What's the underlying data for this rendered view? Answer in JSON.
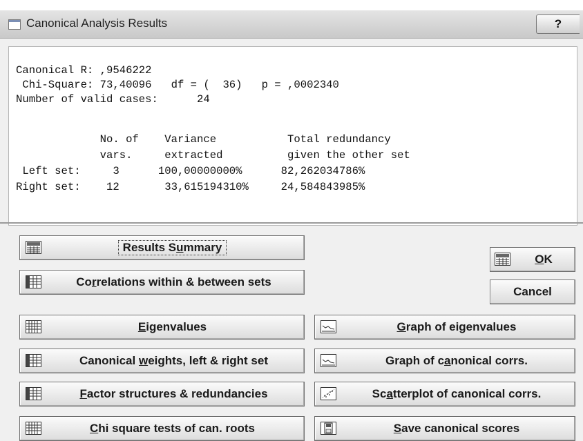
{
  "window": {
    "title": "Canonical Analysis Results",
    "help_label": "?"
  },
  "output": {
    "lines": [
      "Canonical R: ,9546222",
      " Chi-Square: 73,40096   df = (  36)   p = ,0002340",
      "Number of valid cases:      24",
      "",
      "",
      "             No. of    Variance           Total redundancy",
      "             vars.     extracted          given the other set",
      " Left set:     3      100,00000000%      82,262034786%",
      "Right set:    12       33,615194310%     24,584843985%"
    ]
  },
  "buttons": {
    "results_summary": {
      "pre": "Results S",
      "u": "u",
      "post": "mmary",
      "icon": "summary-icon"
    },
    "correlations": {
      "pre": "Co",
      "u": "r",
      "post": "relations within & between sets",
      "icon": "table-icon"
    },
    "eigenvalues": {
      "pre": "",
      "u": "E",
      "post": "igenvalues",
      "icon": "grid-icon"
    },
    "canonical_weights": {
      "pre": "Canonical ",
      "u": "w",
      "post": "eights, left & right set",
      "icon": "table-icon"
    },
    "factor_structures": {
      "pre": "",
      "u": "F",
      "post": "actor structures & redundancies",
      "icon": "table-icon"
    },
    "chi_square": {
      "pre": "",
      "u": "C",
      "post": "hi square tests of can. roots",
      "icon": "grid-icon"
    },
    "ok": {
      "pre": "",
      "u": "O",
      "post": "K",
      "icon": "summary-icon"
    },
    "cancel": {
      "label": "Cancel"
    },
    "graph_eigenvalues": {
      "pre": "",
      "u": "G",
      "post": "raph of eigenvalues",
      "icon": "line-graph-icon"
    },
    "graph_canonical": {
      "pre": "Graph of c",
      "u": "a",
      "post": "nonical corrs.",
      "icon": "line-graph-icon"
    },
    "scatterplot": {
      "pre": "Sc",
      "u": "a",
      "post": "tterplot of canonical corrs.",
      "icon": "scatterplot-icon"
    },
    "save_scores": {
      "pre": "",
      "u": "S",
      "post": "ave canonical scores",
      "icon": "floppy-disk-icon"
    }
  }
}
